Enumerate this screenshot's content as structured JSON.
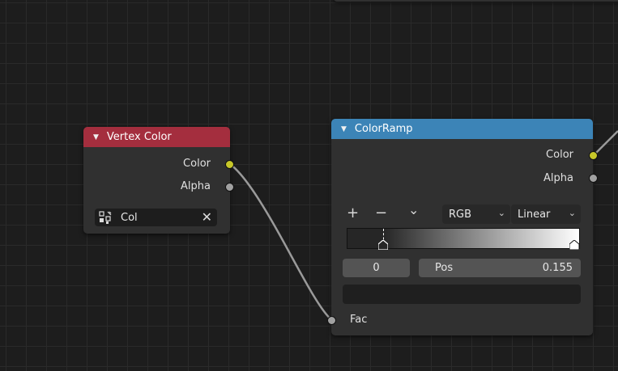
{
  "vertex_color_node": {
    "title": "Vertex Color",
    "header_color": "#a42e3e",
    "outputs": [
      {
        "label": "Color",
        "socket_color": "#c7c729"
      },
      {
        "label": "Alpha",
        "socket_color": "#a1a1a1"
      }
    ],
    "attribute": {
      "icon": "vertex-color-attribute-icon",
      "value": "Col",
      "clear_icon": "close-icon"
    }
  },
  "color_ramp_node": {
    "title": "ColorRamp",
    "header_color": "#3c84b7",
    "outputs": [
      {
        "label": "Color",
        "socket_color": "#c7c729"
      },
      {
        "label": "Alpha",
        "socket_color": "#a1a1a1"
      }
    ],
    "toolbar": {
      "add": "+",
      "remove": "−",
      "menu": "⌄"
    },
    "color_mode": "RGB",
    "interpolation": "Linear",
    "ramp": {
      "stops": [
        {
          "position": 0.155,
          "color": "#262626"
        },
        {
          "position": 1.0,
          "color": "#ffffff"
        }
      ]
    },
    "active_stop_index": "0",
    "pos_label": "Pos",
    "pos_value": "0.155",
    "input": {
      "label": "Fac",
      "socket_color": "#a1a1a1"
    }
  },
  "link": {
    "from": "Vertex Color.Color",
    "to": "ColorRamp.Fac",
    "color": "#9a9a9a"
  }
}
